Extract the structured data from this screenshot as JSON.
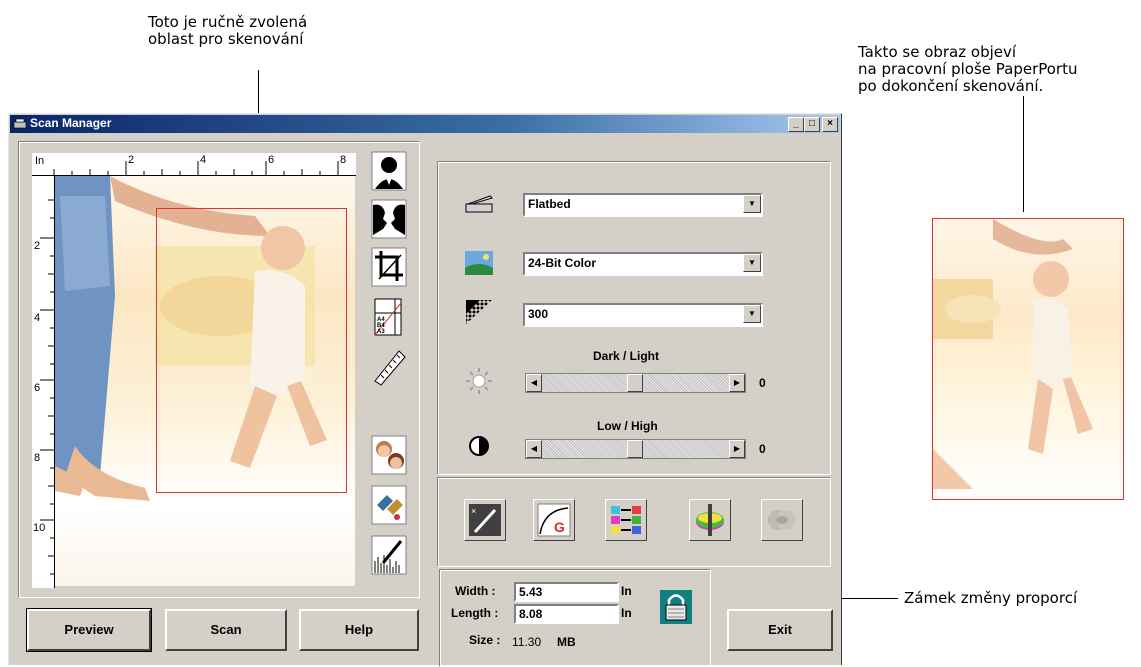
{
  "annotations": {
    "selection_note_line1": "Toto je ručně zvolená",
    "selection_note_line2": "oblast pro skenování",
    "result_note_line1": "Takto se obraz objeví",
    "result_note_line2": "na pracovní ploše PaperPortu",
    "result_note_line3": "po dokončení skenování.",
    "lock_note": "Zámek změny proporcí"
  },
  "window": {
    "title": "Scan Manager",
    "minimize": "_",
    "maximize": "□",
    "close": "×"
  },
  "ruler": {
    "unit": "In",
    "top_ticks": [
      "2",
      "4",
      "6",
      "8"
    ],
    "left_ticks": [
      "2",
      "4",
      "6",
      "8",
      "10"
    ]
  },
  "settings": {
    "source": "Flatbed",
    "color_mode": "24-Bit Color",
    "resolution": "300",
    "brightness_label": "Dark / Light",
    "brightness_value": "0",
    "contrast_label": "Low / High",
    "contrast_value": "0"
  },
  "size": {
    "width_label": "Width :",
    "width_value": "5.43",
    "width_unit": "In",
    "length_label": "Length :",
    "length_value": "8.08",
    "length_unit": "In",
    "size_label": "Size :",
    "size_value": "11.30",
    "size_unit": "MB"
  },
  "buttons": {
    "preview": "Preview",
    "scan": "Scan",
    "help": "Help",
    "exit": "Exit"
  },
  "colors": {
    "window_face": "#d4d0c8",
    "titlebar": "#0a246a",
    "selection_frame": "#e03030"
  }
}
